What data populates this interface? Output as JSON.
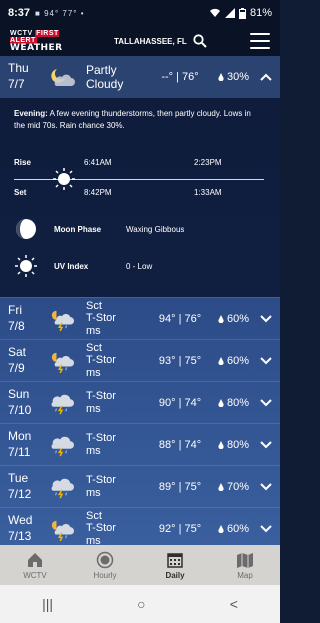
{
  "status": {
    "time": "8:37",
    "left_icons": "■ 94° 77° •",
    "battery": "81%"
  },
  "header": {
    "logo_line1_a": "WCTV",
    "logo_line1_b": "FIRST ALERT",
    "logo_line2": "WEATHER",
    "location": "TALLAHASSEE, FL"
  },
  "expanded_day": {
    "day": "Thu",
    "date": "7/7",
    "condition": "Partly Cloudy",
    "hi": "--°",
    "separator": "|",
    "lo": "76°",
    "rain": "30%",
    "description_label": "Evening:",
    "description": "A few evening thunderstorms, then partly cloudy. Lows in the mid 70s. Rain chance 30%.",
    "rise_label": "Rise",
    "set_label": "Set",
    "sunrise": "6:41AM",
    "sunset": "8:42PM",
    "moonrise": "2:23PM",
    "moonset": "1:33AM",
    "moon_phase_label": "Moon Phase",
    "moon_phase": "Waxing Gibbous",
    "uv_label": "UV Index",
    "uv": "0 - Low"
  },
  "days": [
    {
      "day": "Fri",
      "date": "7/8",
      "cond1": "Sct",
      "cond2": "T-Stor",
      "cond3": "ms",
      "hi": "94°",
      "sep": "|",
      "lo": "76°",
      "rain": "60%",
      "icon": "sun-storm-icon"
    },
    {
      "day": "Sat",
      "date": "7/9",
      "cond1": "Sct",
      "cond2": "T-Stor",
      "cond3": "ms",
      "hi": "93°",
      "sep": "|",
      "lo": "75°",
      "rain": "60%",
      "icon": "sun-storm-icon"
    },
    {
      "day": "Sun",
      "date": "7/10",
      "cond1": "",
      "cond2": "T-Stor",
      "cond3": "ms",
      "hi": "90°",
      "sep": "|",
      "lo": "74°",
      "rain": "80%",
      "icon": "storm-icon"
    },
    {
      "day": "Mon",
      "date": "7/11",
      "cond1": "",
      "cond2": "T-Stor",
      "cond3": "ms",
      "hi": "88°",
      "sep": "|",
      "lo": "74°",
      "rain": "80%",
      "icon": "storm-icon"
    },
    {
      "day": "Tue",
      "date": "7/12",
      "cond1": "",
      "cond2": "T-Stor",
      "cond3": "ms",
      "hi": "89°",
      "sep": "|",
      "lo": "75°",
      "rain": "70%",
      "icon": "storm-icon"
    },
    {
      "day": "Wed",
      "date": "7/13",
      "cond1": "Sct",
      "cond2": "T-Stor",
      "cond3": "ms",
      "hi": "92°",
      "sep": "|",
      "lo": "75°",
      "rain": "60%",
      "icon": "sun-storm-icon"
    }
  ],
  "nav": [
    {
      "label": "WCTV",
      "icon": "home-icon"
    },
    {
      "label": "Hourly",
      "icon": "clock-icon"
    },
    {
      "label": "Daily",
      "icon": "calendar-icon"
    },
    {
      "label": "Map",
      "icon": "map-icon"
    }
  ],
  "system_nav": {
    "recents": "|||",
    "home": "○",
    "back": "<"
  },
  "colors": {
    "accent": "#c8102e",
    "rain_drop": "#ffffff",
    "lightning": "#f2b705"
  }
}
